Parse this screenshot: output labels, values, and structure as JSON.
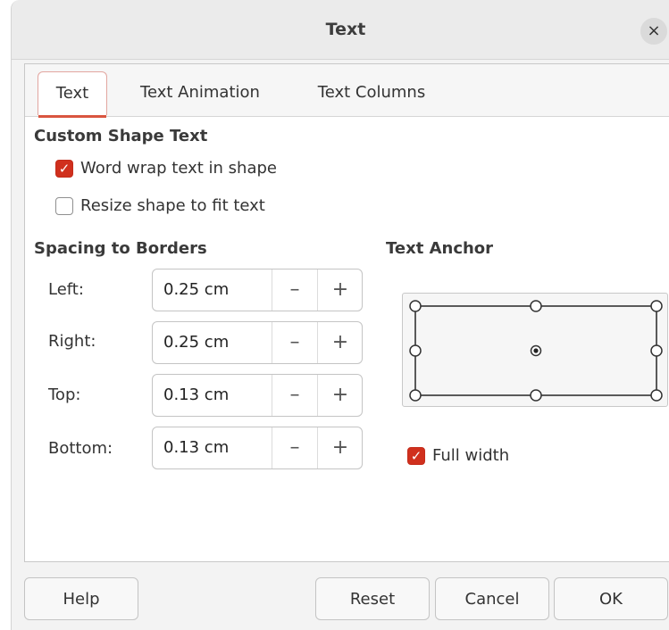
{
  "dialog": {
    "title": "Text",
    "close_label": "×"
  },
  "tabs": [
    {
      "label": "Text",
      "active": true
    },
    {
      "label": "Text Animation",
      "active": false
    },
    {
      "label": "Text Columns",
      "active": false
    }
  ],
  "custom_shape": {
    "heading": "Custom Shape Text",
    "word_wrap": {
      "label": "Word wrap text in shape",
      "checked": true
    },
    "resize": {
      "label": "Resize shape to fit text",
      "checked": false
    }
  },
  "spacing": {
    "heading": "Spacing to Borders",
    "fields": [
      {
        "label": "Left:",
        "value": "0.25 cm"
      },
      {
        "label": "Right:",
        "value": "0.25 cm"
      },
      {
        "label": "Top:",
        "value": "0.13 cm"
      },
      {
        "label": "Bottom:",
        "value": "0.13 cm"
      }
    ],
    "minus_glyph": "–",
    "plus_glyph": "+"
  },
  "anchor": {
    "heading": "Text Anchor",
    "selected": "center",
    "full_width": {
      "label": "Full width",
      "checked": true
    }
  },
  "buttons": {
    "help": "Help",
    "reset": "Reset",
    "cancel": "Cancel",
    "ok": "OK"
  },
  "colors": {
    "accent": "#d0301d",
    "tab_underline": "#d9553f"
  }
}
